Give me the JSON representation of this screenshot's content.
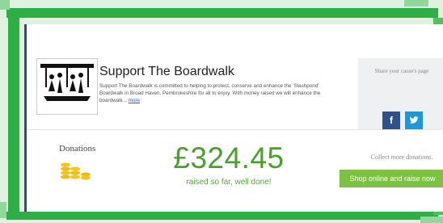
{
  "campaign": {
    "title": "Support The Boardwalk",
    "description": "Support The Boardwalk is committed to helping to protect, conserve and enhance the 'Slashpond' Boardwalk in Broad Haven, Pembrokeshire for all to enjoy. With money raised we will enhance the boardwalk...",
    "more_link": "more",
    "logo_text": "SUPPORT THE BOARDWALK"
  },
  "share": {
    "label": "Share your cause's page",
    "facebook_glyph": "f",
    "twitter_glyph": "t"
  },
  "donations": {
    "label": "Donations",
    "amount": "£324.45",
    "raised_text": "raised so far, well done!",
    "collect_text": "Collect more donations.",
    "shop_button": "Shop online and raise now"
  },
  "colors": {
    "frame_green": "#2fae45",
    "amount_green": "#4d9e30",
    "button_green": "#7cc143",
    "facebook_blue": "#2f5189",
    "twitter_blue": "#1e97d9"
  },
  "icons": [
    "facebook-icon",
    "twitter-icon",
    "coins-icon",
    "boardwalk-logo"
  ]
}
